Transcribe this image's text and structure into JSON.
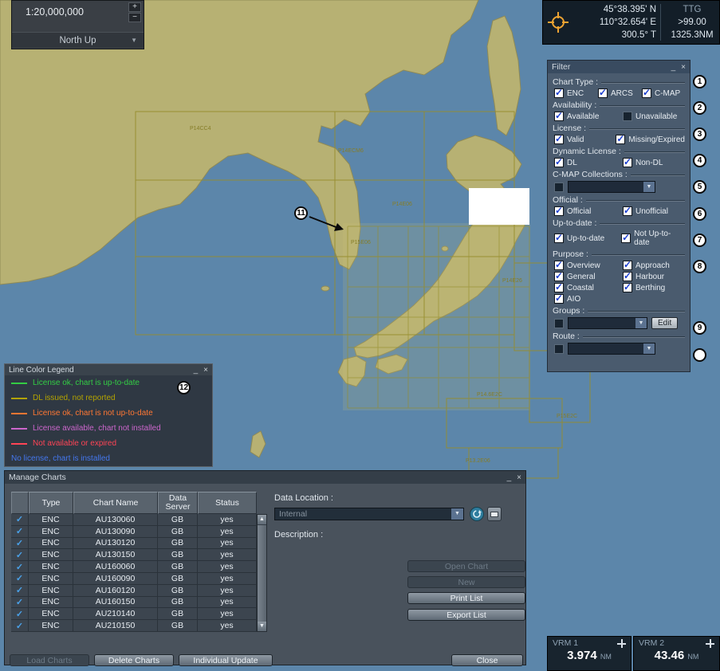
{
  "window_controls": {
    "minimize": "_",
    "close": "×"
  },
  "scale_panel": {
    "scale": "1:20,000,000",
    "zoom_in": "+",
    "zoom_out": "−",
    "orientation": "North Up",
    "dropdown_arrow": "▼"
  },
  "nav_panel": {
    "lat": "45°38.395' N",
    "lon": "110°32.654' E",
    "course": "300.5° T",
    "ttg_label": "TTG",
    "ttg_value": ">99.00",
    "distance": "1325.3NM"
  },
  "filter": {
    "title": "Filter",
    "sections": {
      "chart_type": "Chart Type :",
      "availability": "Availability :",
      "license": "License :",
      "dynamic_license": "Dynamic License :",
      "cmap_collections": "C-MAP Collections :",
      "official": "Official :",
      "up_to_date": "Up-to-date :",
      "purpose": "Purpose :",
      "groups": "Groups :",
      "route": "Route :"
    },
    "options": {
      "enc": "ENC",
      "arcs": "ARCS",
      "cmap": "C-MAP",
      "available": "Available",
      "unavailable": "Unavailable",
      "valid": "Valid",
      "missing_expired": "Missing/Expired",
      "dl": "DL",
      "non_dl": "Non-DL",
      "official": "Official",
      "unofficial": "Unofficial",
      "up_to_date": "Up-to-date",
      "not_up_to_date": "Not Up-to-date",
      "overview": "Overview",
      "approach": "Approach",
      "general": "General",
      "harbour": "Harbour",
      "coastal": "Coastal",
      "berthing": "Berthing",
      "aio": "AIO"
    },
    "states": {
      "enc": true,
      "arcs": true,
      "cmap": true,
      "available": true,
      "unavailable": false,
      "valid": true,
      "missing_expired": true,
      "dl": true,
      "non_dl": true,
      "cmap_collection": false,
      "official": true,
      "unofficial": true,
      "up_to_date": true,
      "not_up_to_date": true,
      "overview": true,
      "approach": true,
      "general": true,
      "harbour": true,
      "coastal": true,
      "berthing": true,
      "aio": true,
      "groups": false,
      "route": false
    },
    "edit_button": "Edit"
  },
  "legend": {
    "title": "Line Color Legend",
    "items": [
      {
        "text": "License ok, chart is up-to-date",
        "color": "#33cc44"
      },
      {
        "text": "DL issued, not reported",
        "color": "#b3a300"
      },
      {
        "text": "License ok, chart is not up-to-date",
        "color": "#ff7733"
      },
      {
        "text": "License available, chart not installed",
        "color": "#cc66cc"
      },
      {
        "text": "Not available or expired",
        "color": "#ff4455"
      },
      {
        "text": "No license, chart is installed",
        "color": "#4477ee"
      }
    ]
  },
  "manage_charts": {
    "title": "Manage Charts",
    "headers": {
      "type": "Type",
      "chart_name": "Chart Name",
      "data_server": "Data Server",
      "status": "Status"
    },
    "rows": [
      {
        "checked": true,
        "type": "ENC",
        "name": "AU130060",
        "server": "GB",
        "status": "yes"
      },
      {
        "checked": true,
        "type": "ENC",
        "name": "AU130090",
        "server": "GB",
        "status": "yes"
      },
      {
        "checked": true,
        "type": "ENC",
        "name": "AU130120",
        "server": "GB",
        "status": "yes"
      },
      {
        "checked": true,
        "type": "ENC",
        "name": "AU130150",
        "server": "GB",
        "status": "yes"
      },
      {
        "checked": true,
        "type": "ENC",
        "name": "AU160060",
        "server": "GB",
        "status": "yes"
      },
      {
        "checked": true,
        "type": "ENC",
        "name": "AU160090",
        "server": "GB",
        "status": "yes"
      },
      {
        "checked": true,
        "type": "ENC",
        "name": "AU160120",
        "server": "GB",
        "status": "yes"
      },
      {
        "checked": true,
        "type": "ENC",
        "name": "AU160150",
        "server": "GB",
        "status": "yes"
      },
      {
        "checked": true,
        "type": "ENC",
        "name": "AU210140",
        "server": "GB",
        "status": "yes"
      },
      {
        "checked": true,
        "type": "ENC",
        "name": "AU210150",
        "server": "GB",
        "status": "yes"
      }
    ],
    "data_location_label": "Data Location :",
    "data_location_value": "Internal",
    "description_label": "Description :",
    "buttons": {
      "open_chart": "Open Chart",
      "new": "New",
      "print_list": "Print List",
      "export_list": "Export List",
      "load_charts": "Load Charts",
      "delete_charts": "Delete Charts",
      "individual_update": "Individual Update",
      "close": "Close"
    }
  },
  "vrm": {
    "vrm1_label": "VRM 1",
    "vrm1_value": "3.974",
    "vrm1_unit": "NM",
    "vrm2_label": "VRM 2",
    "vrm2_value": "43.46",
    "vrm2_unit": "NM"
  },
  "map": {
    "colors": {
      "sea": "#5c86aa",
      "land": "#b7b173",
      "grid": "#958d2c"
    },
    "labels": [
      {
        "text": "P14CC4"
      },
      {
        "text": "P14ECM6"
      },
      {
        "text": "P14E06"
      },
      {
        "text": "P15E06"
      },
      {
        "text": "P14E26"
      },
      {
        "text": "P14.6E2C"
      },
      {
        "text": "P13.2E06"
      },
      {
        "text": "P15E2C"
      }
    ]
  },
  "callouts": {
    "numbers": [
      "1",
      "2",
      "3",
      "4",
      "5",
      "6",
      "7",
      "8",
      "9",
      "",
      "11",
      "12"
    ]
  }
}
